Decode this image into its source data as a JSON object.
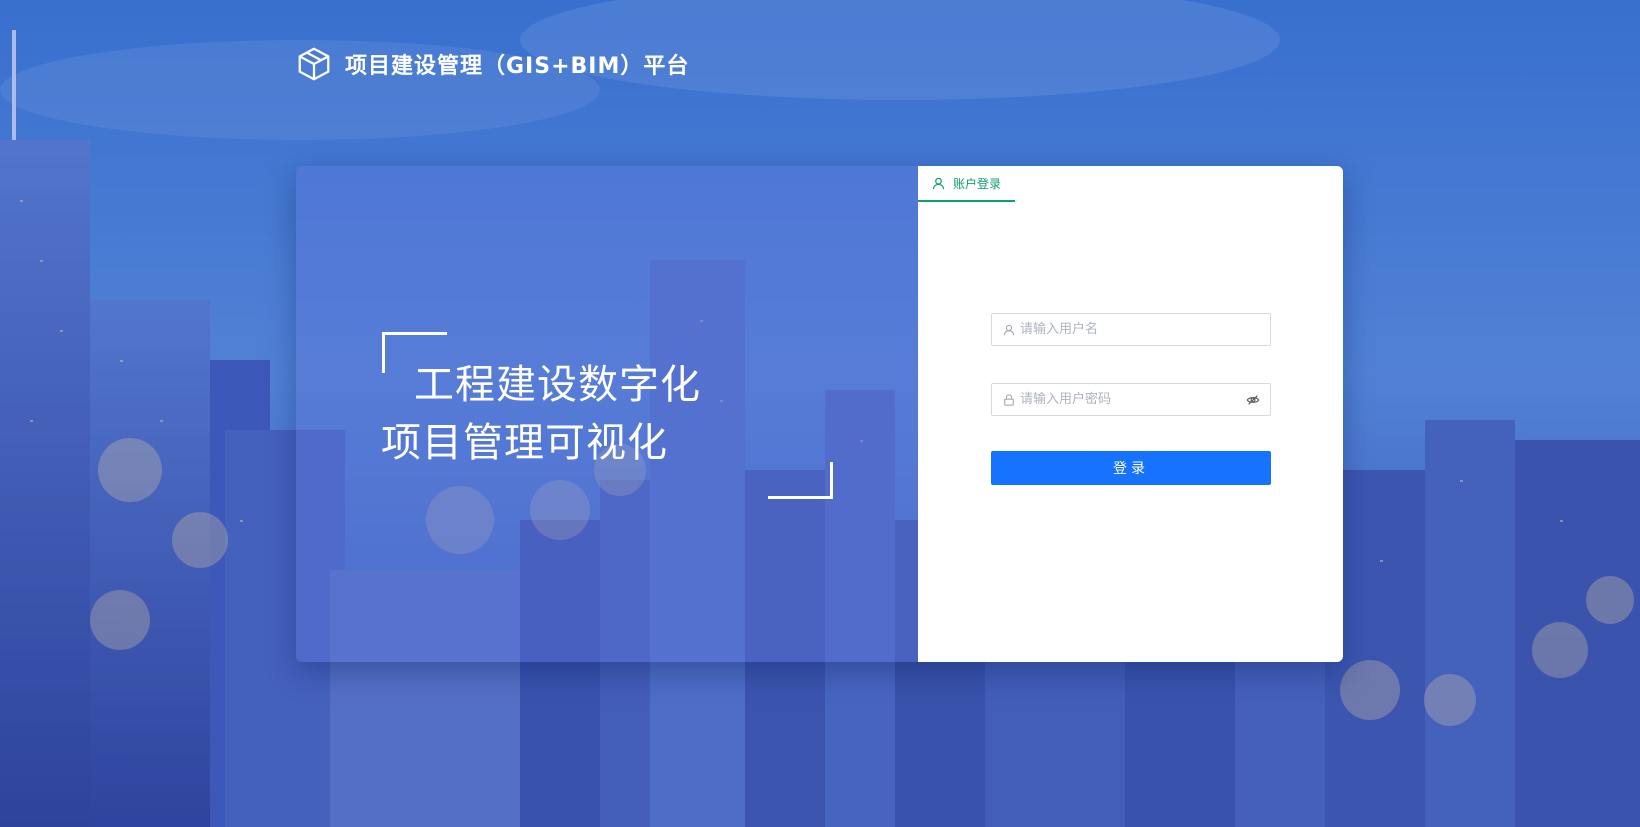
{
  "header": {
    "title": "项目建设管理（GIS+BIM）平台",
    "logo_icon": "cube-icon"
  },
  "hero": {
    "line1": "工程建设数字化",
    "line2": "项目管理可视化"
  },
  "login": {
    "tab_label": "账户登录",
    "tab_icon": "user-icon",
    "username_placeholder": "请输入用户名",
    "username_value": "",
    "password_placeholder": "请输入用户密码",
    "password_value": "",
    "password_toggle_icon": "eye-slash-icon",
    "submit_label": "登录"
  },
  "colors": {
    "accent_green": "#0e9f6e",
    "primary_blue": "#1673ff",
    "background_blue": "#3f7ed6"
  }
}
